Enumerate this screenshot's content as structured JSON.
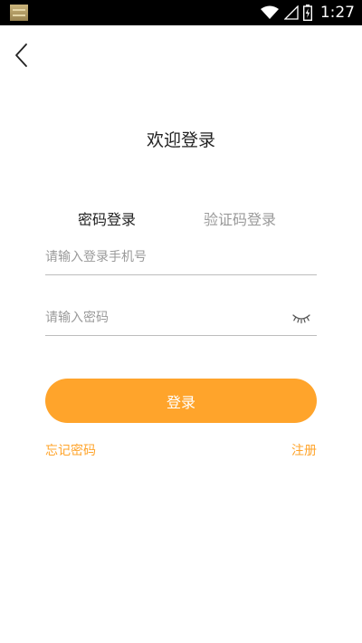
{
  "status_bar": {
    "time": "1:27",
    "icons": [
      "app-notification-icon",
      "wifi-icon",
      "signal-icon",
      "battery-charging-icon"
    ]
  },
  "header": {
    "back_icon": "chevron-left-icon"
  },
  "title": "欢迎登录",
  "tabs": [
    {
      "label": "密码登录",
      "active": true
    },
    {
      "label": "验证码登录",
      "active": false
    }
  ],
  "form": {
    "phone_placeholder": "请输入登录手机号",
    "phone_value": "",
    "password_placeholder": "请输入密码",
    "password_value": "",
    "password_toggle_icon": "eye-closed-icon"
  },
  "login_button_label": "登录",
  "links": {
    "forgot_password": "忘记密码",
    "register": "注册"
  },
  "colors": {
    "accent": "#ffa42b",
    "text_primary": "#222222",
    "text_secondary": "#9a9a9a",
    "divider": "#bdbdbd"
  }
}
